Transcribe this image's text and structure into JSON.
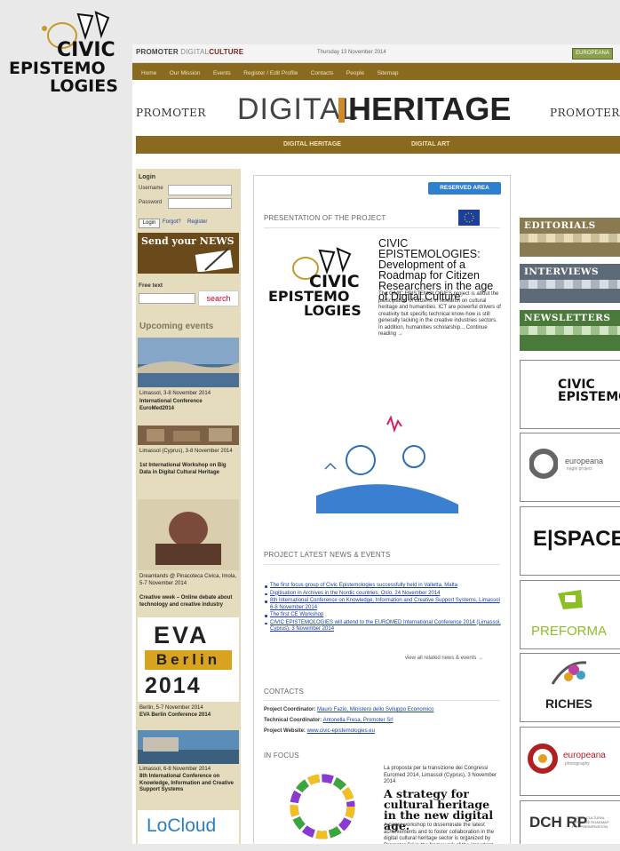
{
  "corner_logo": {
    "line1": "CIVIC",
    "line2": "EPISTEMO",
    "line3": "LOGIES"
  },
  "topbar": {
    "brand_prefix": "PROMOTER",
    "brand_digital": "DIGITAL",
    "brand_culture": "CULTURE",
    "date": "Thursday 13 November 2014",
    "badge": "EUROPEANA"
  },
  "nav": [
    "Home",
    "Our Mission",
    "Events",
    "Register / Edit Profile",
    "Contacts",
    "People",
    "Sitemap"
  ],
  "banner": {
    "promoter_left": "PROMOTER",
    "digital": "DIGITAL",
    "heritage": "HERITAGE",
    "promoter_right": "PROMOTER"
  },
  "subnav": [
    "DIGITAL HERITAGE",
    "DIGITAL ART"
  ],
  "login": {
    "title": "Login",
    "username_label": "Username",
    "password_label": "Password",
    "login_button": "Login",
    "forgot": "Forgot?",
    "register": "Register"
  },
  "send_news": "Send your NEWS",
  "search": {
    "label": "Free text",
    "button": "search"
  },
  "upcoming": {
    "title": "Upcoming events",
    "events": [
      {
        "date": "Limassol, 3-8 November 2014",
        "title": "International Conference EuroMed2014"
      },
      {
        "date": "Limassol (Cyprus), 3-8 November 2014",
        "title": "1st International Workshop on Big Data in Digital Cultural Heritage"
      },
      {
        "date": "Dreamlands @ Pinacoteca Civica, Imola, 5-7 November 2014",
        "title": "Creative week – Online debate about technology and creative industry"
      },
      {
        "date": "Berlin, 5-7 November 2014",
        "title": "EVA Berlin Conference 2014"
      },
      {
        "date": "Limassol, 6-8 November 2014",
        "title": "8th International Conference on Knowledge, Information and Creative Support Systems"
      }
    ]
  },
  "eva": {
    "line1": "EVA",
    "line2": "Berlin",
    "line3": "2014"
  },
  "locloud": "LoCloud",
  "center": {
    "reserved": "RESERVED AREA",
    "presentation_title": "PRESENTATION OF THE PROJECT",
    "project_title": "CIVIC EPISTEMOLOGIES: Development of a Roadmap for Citizen Researchers in the age of Digital Culture",
    "project_para": "The CIVIC EPISTEMOLOGIES project is about the participation of citizens in research on cultural heritage and humanities. ICT are powerful drivers of creativity but specific technical know-how is still generally lacking in the creative industries sectors. In addition, humanities scholarship... Continue reading →",
    "news_title": "PROJECT LATEST NEWS & EVENTS",
    "news": [
      "The first focus group of Civic Epistemologies successfully held in Valletta, Malta",
      "Digitisation in Archives in the Nordic countries, Oslo, 24 November 2014",
      "8th International Conference on Knowledge, Information and Creative Support Systems, Limassol 6-8 November 2014",
      "The first CE Workshop",
      "CIVIC EPISTEMOLOGIES will attend to the EUROMED International Conference 2014 (Limassol, Cyprus), 3 November 2014"
    ],
    "view_all": "view all related news & events →",
    "contacts_title": "CONTACTS",
    "coordinator_label": "Project Coordinator:",
    "coordinator": "Mauro Fazio, Ministero dello Sviluppo Economico",
    "tech_label": "Technical Coordinator:",
    "tech": "Antonella Fresa, Promoter Srl",
    "website_label": "Project Website:",
    "website": "www.civic-epistemologies.eu",
    "focus_title": "IN FOCUS",
    "focus_date": "La proposta per la transizione dei Congressi Euromed 2014, Limassol (Cyprus), 3 November 2014",
    "focus_heading": "A strategy for cultural heritage in the new digital age.",
    "focus_para": "A panel workshop to disseminate the latest achievements and to foster collaboration in the digital cultural heritage sector is organized by Promoter Srl in the framework of the important congress Euromed 2014. EU projects, representatives and professionals..."
  },
  "right": {
    "editorials": "EDITORIALS",
    "interviews": "INTERVIEWS",
    "newsletters": "NEWSLETTERS",
    "logos": [
      "CIVIC EPISTEMOLOGIES",
      "europeana",
      "E|SPACE",
      "PREFORMA",
      "RICHES",
      "europeana",
      "DCH RP"
    ],
    "logo_sub": {
      "europeana1": "eagle project",
      "europeana2": "photography",
      "dch": "DIGITAL CULTURAL HERITAGE ROADMAP FOR PRESERVATION"
    }
  },
  "colors": {
    "nav": "#8a6a1e",
    "left_bg": "#e5dcbe",
    "editorial_head": "#8a7a52",
    "interviews_head": "#5d6a78",
    "newsletters_head": "#4a7a3a",
    "reserved": "#2f7fd1",
    "link": "#1b3f9c"
  }
}
